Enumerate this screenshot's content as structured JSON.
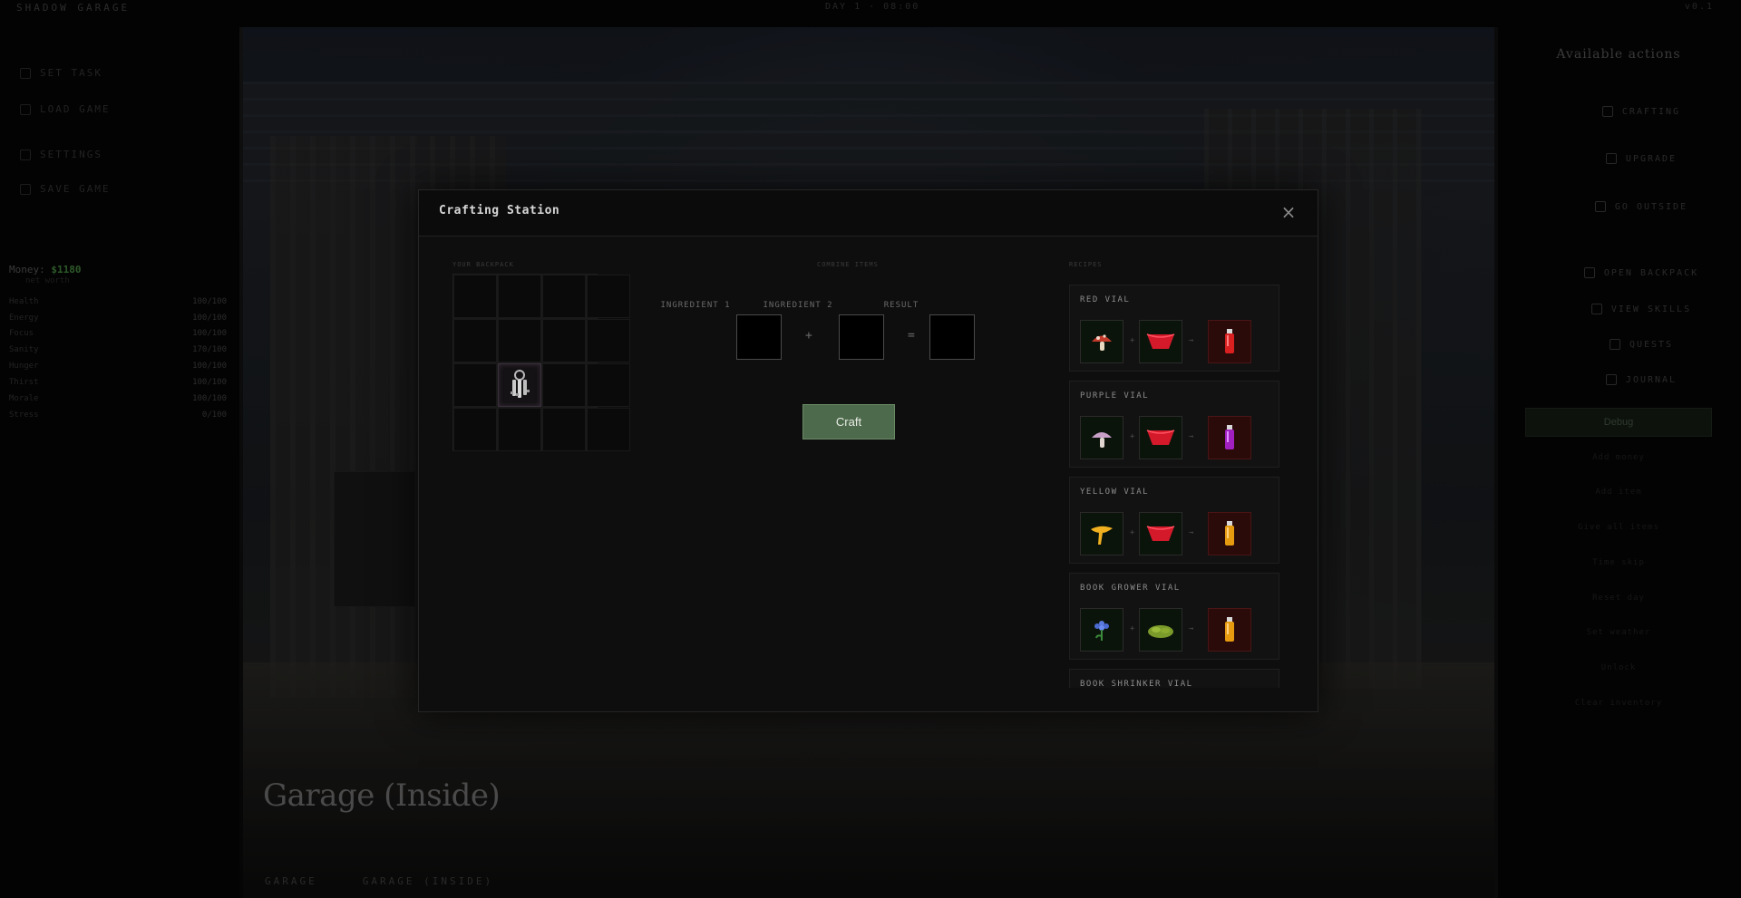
{
  "topbar": {
    "brand": "SHADOW GARAGE",
    "center": "DAY 1 · 08:00",
    "right": "v0.1"
  },
  "sidebar": {
    "nav": [
      {
        "label": "SET TASK",
        "icon": "task-icon"
      },
      {
        "label": "LOAD GAME",
        "icon": "load-icon"
      },
      {
        "label": "SETTINGS",
        "icon": "settings-icon"
      },
      {
        "label": "SAVE GAME",
        "icon": "save-icon"
      }
    ],
    "money_label": "Money:",
    "money_value": "$1180",
    "money_sub": "net worth",
    "stats": [
      {
        "label": "Health",
        "value": "100/100"
      },
      {
        "label": "Energy",
        "value": "100/100"
      },
      {
        "label": "Focus",
        "value": "100/100"
      },
      {
        "label": "Sanity",
        "value": "170/100"
      },
      {
        "label": "Hunger",
        "value": "100/100"
      },
      {
        "label": "Thirst",
        "value": "100/100"
      },
      {
        "label": "Morale",
        "value": "100/100"
      },
      {
        "label": "Stress",
        "value": "0/100"
      }
    ]
  },
  "actions": {
    "title": "Available actions",
    "items": [
      {
        "label": "CRAFTING",
        "icon": "layers-icon"
      },
      {
        "label": "UPGRADE",
        "icon": "arrow-up-icon"
      },
      {
        "label": "GO OUTSIDE",
        "icon": "exit-icon"
      },
      {
        "label": "OPEN BACKPACK",
        "icon": "backpack-icon"
      },
      {
        "label": "VIEW SKILLS",
        "icon": "user-icon"
      },
      {
        "label": "QUESTS",
        "icon": "scroll-icon"
      },
      {
        "label": "JOURNAL",
        "icon": "book-icon"
      }
    ],
    "debug_label": "Debug",
    "debug_items": [
      "Add money",
      "Add item",
      "Give all items",
      "Time skip",
      "Reset day",
      "Set weather",
      "Unlock",
      "Clear inventory"
    ]
  },
  "location": {
    "title": "Garage (Inside)",
    "crumbs": [
      "GARAGE",
      "GARAGE (INSIDE)"
    ]
  },
  "modal": {
    "title": "Crafting Station",
    "close_symbol": "×",
    "backpack_label": "YOUR BACKPACK",
    "combine_label": "COMBINE ITEMS",
    "recipes_label": "RECIPES",
    "ingredient1_label": "INGREDIENT 1",
    "ingredient2_label": "INGREDIENT 2",
    "result_label": "RESULT",
    "plus": "+",
    "equals": "=",
    "craft_label": "Craft",
    "backpack": [
      {
        "slot": 9,
        "item": "keys",
        "icon": "keys-icon"
      }
    ],
    "recipes": [
      {
        "name": "RED VIAL",
        "a": "red-mushroom-icon",
        "b": "red-cloth-icon",
        "result": "red-vial-icon",
        "result_color": "#d92020"
      },
      {
        "name": "PURPLE VIAL",
        "a": "purple-mushroom-icon",
        "b": "red-cloth-icon",
        "result": "purple-vial-icon",
        "result_color": "#a020c0"
      },
      {
        "name": "YELLOW VIAL",
        "a": "yellow-mushroom-icon",
        "b": "red-cloth-icon",
        "result": "yellow-vial-icon",
        "result_color": "#e69a10"
      },
      {
        "name": "BOOK GROWER VIAL",
        "a": "blue-flower-icon",
        "b": "green-moss-icon",
        "result": "yellow-vial-icon",
        "result_color": "#e69a10"
      },
      {
        "name": "BOOK SHRINKER VIAL",
        "a": "",
        "b": "",
        "result": "",
        "result_color": ""
      }
    ]
  }
}
